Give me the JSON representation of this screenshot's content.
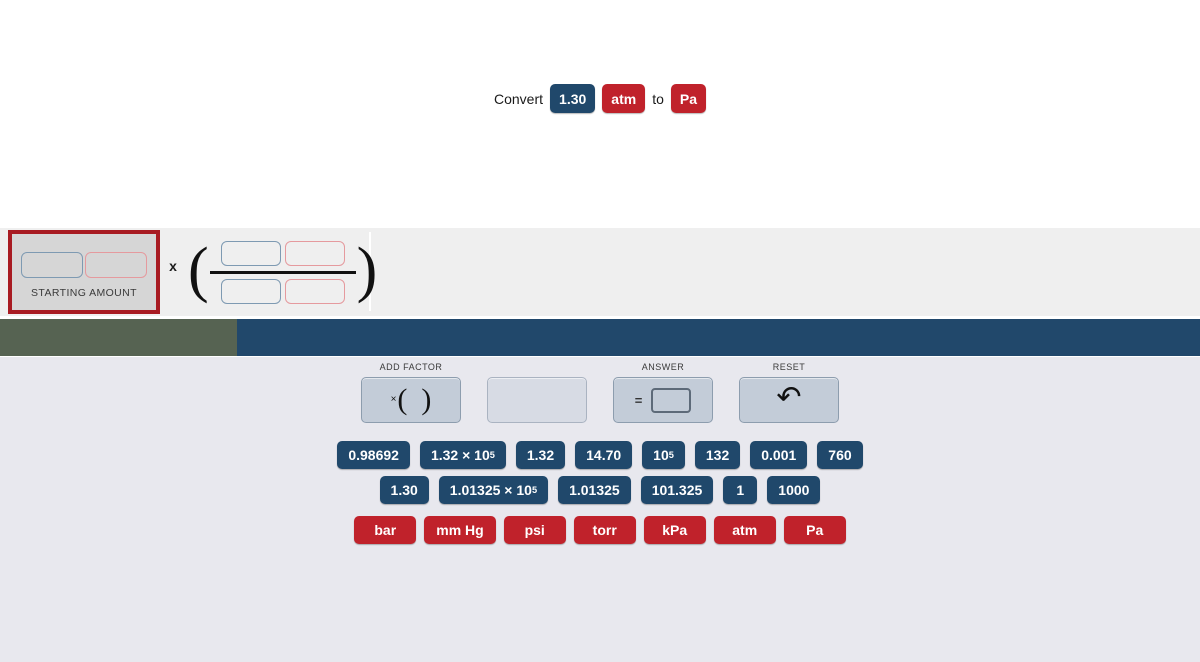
{
  "prompt": {
    "lead_word": "Convert",
    "value": "1.30",
    "from_unit": "atm",
    "connector": "to",
    "to_unit": "Pa"
  },
  "work_area": {
    "starting_amount": {
      "label": "STARTING AMOUNT",
      "value_slot": "",
      "unit_slot": ""
    },
    "operator": "x",
    "factor": {
      "numerator_value_slot": "",
      "numerator_unit_slot": "",
      "denominator_value_slot": "",
      "denominator_unit_slot": ""
    }
  },
  "tools": [
    {
      "label": "ADD FACTOR",
      "icon": "multiply-parentheses-icon",
      "multiply_symbol": "×",
      "left_paren": "(",
      "right_paren": ")"
    },
    {
      "label": "",
      "icon": "empty-slot-icon"
    },
    {
      "label": "ANSWER",
      "icon": "equals-box-icon",
      "equals_symbol": "="
    },
    {
      "label": "RESET",
      "icon": "undo-arrow-icon",
      "undo_symbol": "↶"
    }
  ],
  "number_tiles": [
    [
      {
        "text": "0.98692"
      },
      {
        "text": "1.32 × 10",
        "sup": "5"
      },
      {
        "text": "1.32"
      },
      {
        "text": "14.70"
      },
      {
        "text": "10",
        "sup": "5"
      },
      {
        "text": "132"
      },
      {
        "text": "0.001"
      },
      {
        "text": "760"
      }
    ],
    [
      {
        "text": "1.30"
      },
      {
        "text": "1.01325 × 10",
        "sup": "5"
      },
      {
        "text": "1.01325"
      },
      {
        "text": "101.325"
      },
      {
        "text": "1"
      },
      {
        "text": "1000"
      }
    ]
  ],
  "unit_tiles": [
    "bar",
    "mm Hg",
    "psi",
    "torr",
    "kPa",
    "atm",
    "Pa"
  ],
  "colors": {
    "number_tile": "#20486b",
    "unit_tile": "#c0222b",
    "bar_green": "#566352",
    "bar_navy": "#21486b",
    "work_area": "#efefef",
    "bottom_panel": "#e8e8ee",
    "start_cell_border": "#a81b22",
    "start_cell_fill": "#d6d6d6",
    "tool_button": "#c3ccd8"
  }
}
